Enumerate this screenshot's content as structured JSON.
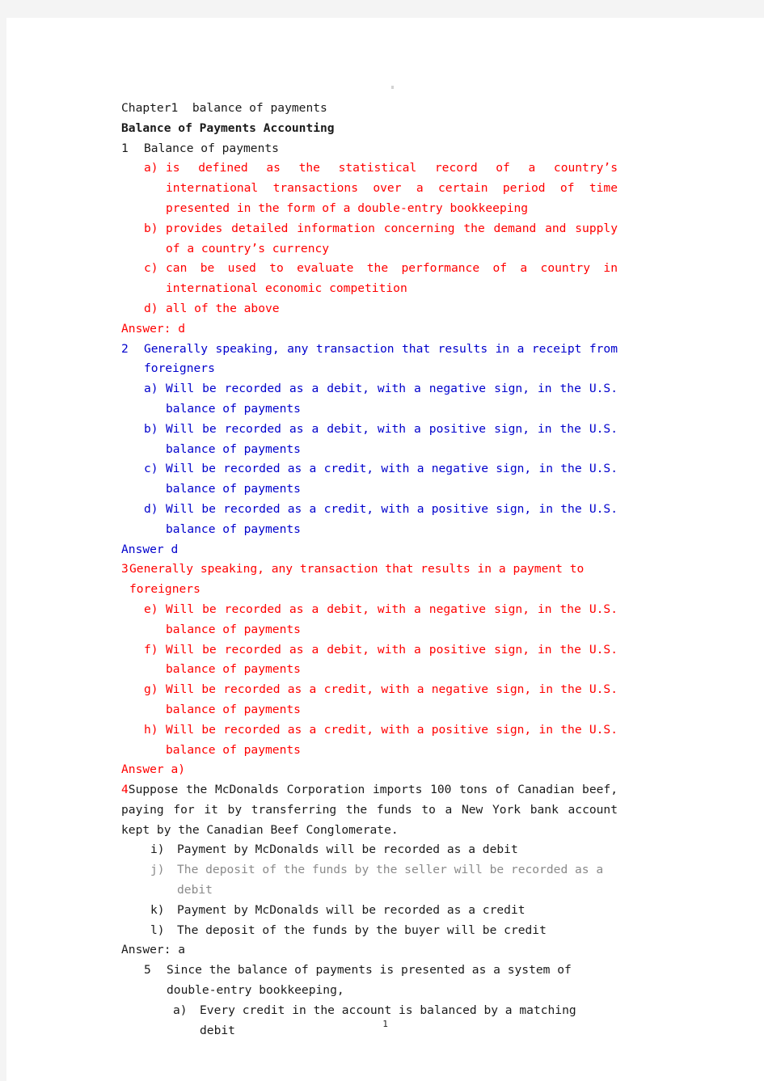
{
  "document": {
    "chapter_title": "Chapter1  balance of payments",
    "section_heading": "Balance of Payments Accounting",
    "page_number": "1"
  },
  "questions": [
    {
      "number": "1",
      "stem": "Balance of payments",
      "stem_color": "black",
      "options": [
        {
          "marker": "a)",
          "text": "is defined as the statistical record of a country’s international transactions over a certain period of time presented in the form of a double-entry bookkeeping",
          "color": "red"
        },
        {
          "marker": "b)",
          "text": "provides detailed information concerning the demand and supply of a country’s currency",
          "color": "red"
        },
        {
          "marker": "c)",
          "text": "can be used to evaluate the performance of a country in international economic competition",
          "color": "red"
        },
        {
          "marker": "d)",
          "text": "all of the above",
          "color": "red"
        }
      ],
      "answer": "Answer: d",
      "answer_color": "red"
    },
    {
      "number": "2",
      "stem": "Generally speaking, any transaction that results in a receipt from foreigners",
      "stem_color": "blue",
      "options": [
        {
          "marker": "a)",
          "text": "Will be recorded as a debit, with a negative sign, in the U.S. balance of payments",
          "color": "blue"
        },
        {
          "marker": "b)",
          "text": "Will be recorded as a debit, with a positive sign, in the U.S. balance of payments",
          "color": "blue"
        },
        {
          "marker": "c)",
          "text": "Will be recorded as a credit, with a negative sign, in the U.S. balance of payments",
          "color": "blue"
        },
        {
          "marker": "d)",
          "text": "Will be recorded as a credit, with a positive sign, in the U.S. balance of payments",
          "color": "blue"
        }
      ],
      "answer": "Answer d",
      "answer_color": "blue"
    },
    {
      "number": "3",
      "stem": "Generally speaking, any transaction that results in a payment to foreigners",
      "stem_color": "red",
      "options": [
        {
          "marker": "e)",
          "text": "Will be recorded as a debit, with a negative sign, in the U.S. balance of payments",
          "color": "red"
        },
        {
          "marker": "f)",
          "text": "Will be recorded as a debit, with a positive sign, in the U.S. balance of payments",
          "color": "red"
        },
        {
          "marker": "g)",
          "text": "Will be recorded as a credit, with a negative sign, in the U.S. balance of payments",
          "color": "red"
        },
        {
          "marker": "h)",
          "text": "Will be recorded as a credit, with a positive sign, in the U.S. balance of payments",
          "color": "red"
        }
      ],
      "answer": "Answer a)",
      "answer_color": "red"
    },
    {
      "number": "4",
      "stem": "Suppose the McDonalds Corporation imports 100 tons of Canadian beef, paying for it by transferring the funds to a New York bank account kept by the Canadian Beef Conglomerate.",
      "stem_color": "black",
      "number_color": "red",
      "options": [
        {
          "marker": "i)",
          "text": "Payment by McDonalds will be recorded as a debit",
          "color": "black"
        },
        {
          "marker": "j)",
          "text": "The deposit of the funds by the seller will be recorded as a debit",
          "color": "gray"
        },
        {
          "marker": "k)",
          "text": "Payment by McDonalds will be recorded as a credit",
          "color": "black"
        },
        {
          "marker": "l)",
          "text": "The deposit of the funds by the buyer will be credit",
          "color": "black"
        }
      ],
      "answer": "Answer: a",
      "answer_color": "black"
    },
    {
      "number": "5",
      "stem": "Since the balance of payments is presented as a system of double-entry bookkeeping,",
      "stem_color": "black",
      "options": [
        {
          "marker": "a)",
          "text": "Every credit in the account is balanced by a matching debit",
          "color": "black"
        }
      ],
      "answer": "",
      "answer_color": "black"
    }
  ]
}
